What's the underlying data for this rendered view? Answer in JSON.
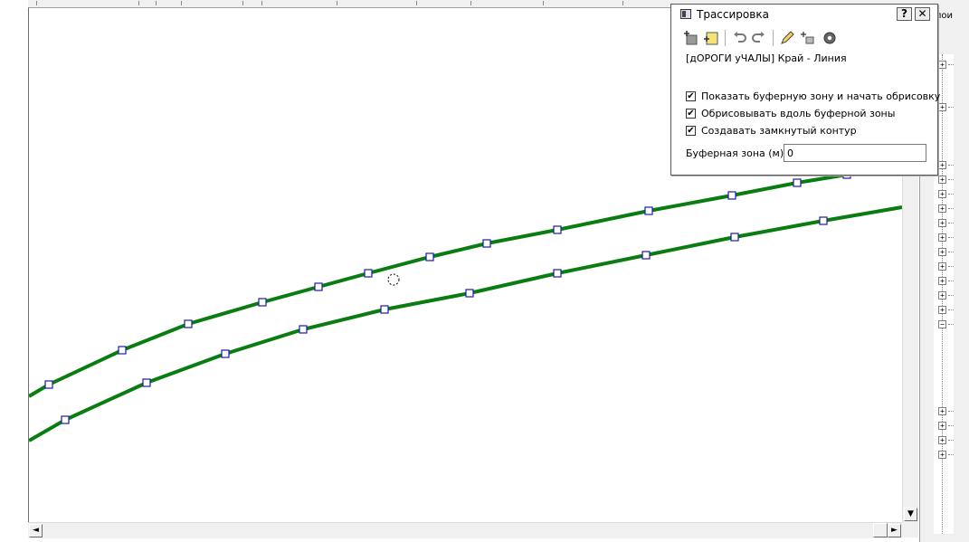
{
  "dialog": {
    "title": "Трассировка",
    "help_button": "?",
    "close_button": "✕",
    "layer_label": "[дОРОГИ уЧАЛЫ] Край - Линия",
    "checkboxes": [
      {
        "label": "Показать буферную зону и начать обрисовку",
        "checked": true
      },
      {
        "label": "Обрисовывать вдоль буферной зоны",
        "checked": true
      },
      {
        "label": "Создавать замкнутый контур",
        "checked": true
      }
    ],
    "buffer_label": "Буферная зона (м):",
    "buffer_value": "0",
    "toolbar_icons": [
      "add-node-icon",
      "add-layer-icon",
      "undo-icon",
      "redo-icon",
      "edit-pen-icon",
      "sparkle-node-icon",
      "settings-gear-icon"
    ]
  },
  "right_panel": {
    "header": "лои"
  },
  "scrollbars": {
    "left_arrow": "◄",
    "right_arrow": "►",
    "down_arrow": "▼"
  },
  "map": {
    "line_color": "#0a7d12",
    "vertex_fill": "#ffffff",
    "vertex_stroke": "#1a1aa8"
  }
}
